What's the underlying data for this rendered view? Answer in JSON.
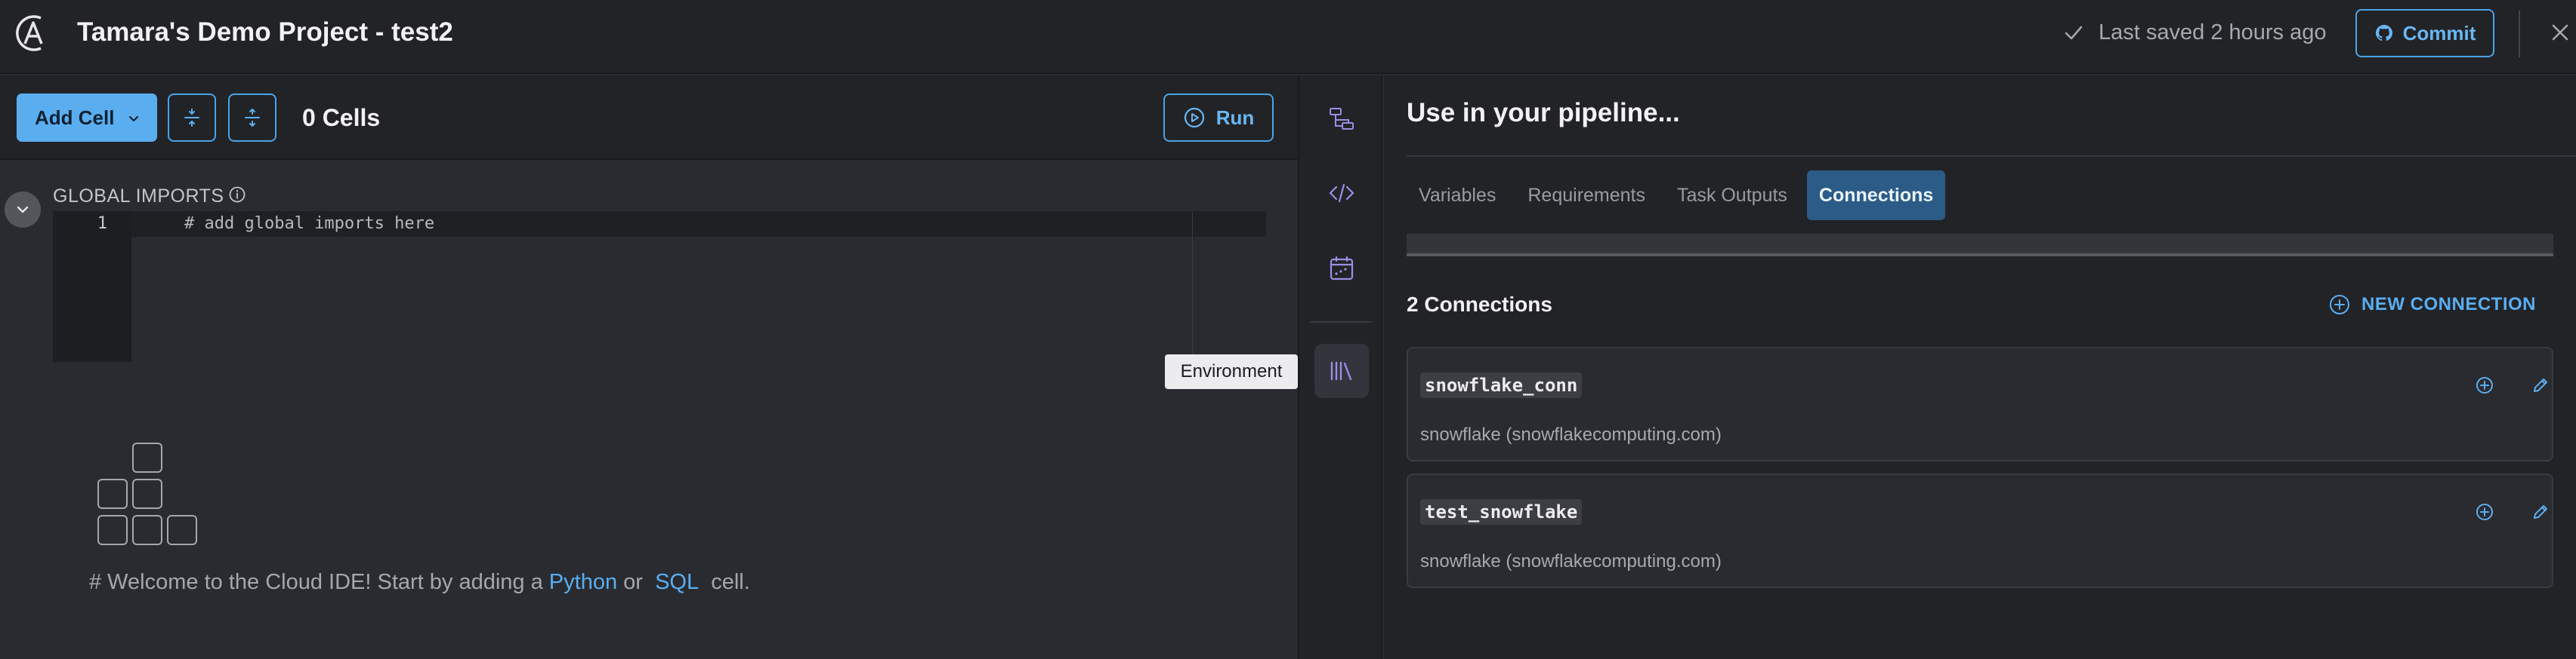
{
  "header": {
    "project_title": "Tamara's Demo Project - test2",
    "saved_status": "Last saved 2 hours ago",
    "commit_label": "Commit"
  },
  "toolbar": {
    "add_cell_label": "Add Cell",
    "cells_count": "0 Cells",
    "run_label": "Run"
  },
  "editor": {
    "global_imports_label": "GLOBAL IMPORTS",
    "line_number": "1",
    "code_line": "# add global imports here"
  },
  "tooltip": {
    "text": "Environment"
  },
  "welcome": {
    "prefix": "# Welcome to the Cloud IDE! Start by adding a",
    "python_link": "Python",
    "or_text": "or",
    "sql_link": "SQL",
    "suffix": "cell."
  },
  "panel": {
    "title": "Use in your pipeline...",
    "tabs": [
      {
        "label": "Variables",
        "active": false
      },
      {
        "label": "Requirements",
        "active": false
      },
      {
        "label": "Task Outputs",
        "active": false
      },
      {
        "label": "Connections",
        "active": true
      }
    ],
    "connections_count": "2 Connections",
    "new_connection_label": "NEW CONNECTION",
    "connections": [
      {
        "name": "snowflake_conn",
        "type": "snowflake (snowflakecomputing.com)"
      },
      {
        "name": "test_snowflake",
        "type": "snowflake (snowflakecomputing.com)"
      }
    ]
  },
  "colors": {
    "accent": "#5aaef0",
    "active_tab": "#2b5b86",
    "rail_icon": "#8f7fe0"
  },
  "icons": {
    "logo": "astronomer-logo-icon",
    "saved": "check-icon",
    "commit": "github-icon",
    "close": "close-icon",
    "rail": [
      "pipeline-graph-icon",
      "code-icon",
      "schedule-icon",
      "environment-library-icon"
    ]
  }
}
